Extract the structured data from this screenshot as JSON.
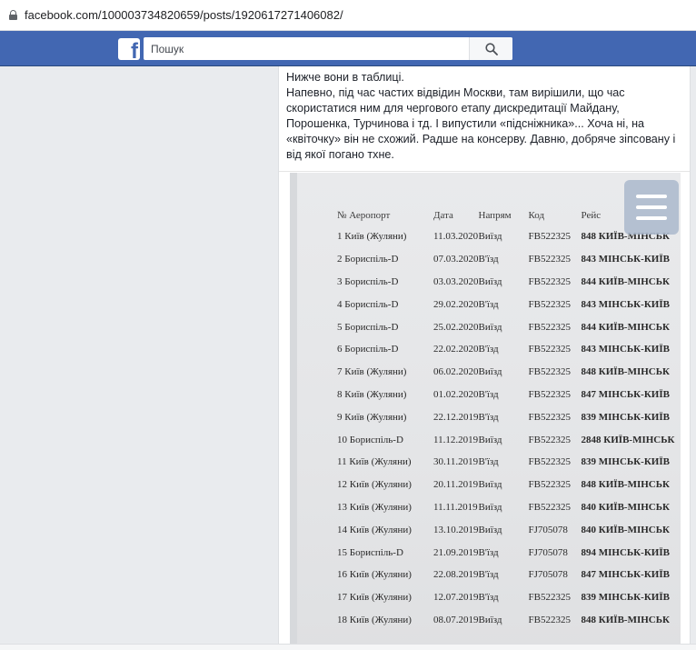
{
  "browser": {
    "url": "facebook.com/100003734820659/posts/1920617271406082/"
  },
  "header": {
    "search_placeholder": "Пошук",
    "logo_letter": "f"
  },
  "post": {
    "text_lines": [
      "Нижче вони в таблиці.",
      "Напевно, під час частих відвідин Москви, там вирішили, що час скористатися ним для чергового етапу дискредитації Майдану, Порошенка, Турчинова і тд. І випустили «підсніжника»... Хоча ні, на «квіточку» він не схожий. Радше на консерву. Давню, добряче зіпсовану і від якої погано тхне."
    ]
  },
  "table": {
    "headers": [
      "№ Аеропорт",
      "Дата",
      "Напрям",
      "Код",
      "Рейс"
    ],
    "rows": [
      [
        "1 Київ (Жуляни)",
        "11.03.2020",
        "Виїзд",
        "FB522325",
        "848 КИЇВ-МІНСЬК"
      ],
      [
        "2 Бориспіль-D",
        "07.03.2020",
        "В'їзд",
        "FB522325",
        "843 МІНСЬК-КИЇВ"
      ],
      [
        "3 Бориспіль-D",
        "03.03.2020",
        "Виїзд",
        "FB522325",
        "844 КИЇВ-МІНСЬК"
      ],
      [
        "4 Бориспіль-D",
        "29.02.2020",
        "В'їзд",
        "FB522325",
        "843 МІНСЬК-КИЇВ"
      ],
      [
        "5 Бориспіль-D",
        "25.02.2020",
        "Виїзд",
        "FB522325",
        "844 КИЇВ-МІНСЬК"
      ],
      [
        "6 Бориспіль-D",
        "22.02.2020",
        "В'їзд",
        "FB522325",
        "843 МІНСЬК-КИЇВ"
      ],
      [
        "7 Київ (Жуляни)",
        "06.02.2020",
        "Виїзд",
        "FB522325",
        "848 КИЇВ-МІНСЬК"
      ],
      [
        "8 Київ (Жуляни)",
        "01.02.2020",
        "В'їзд",
        "FB522325",
        "847 МІНСЬК-КИЇВ"
      ],
      [
        "9 Київ (Жуляни)",
        "22.12.2019",
        "В'їзд",
        "FB522325",
        "839 МІНСЬК-КИЇВ"
      ],
      [
        "10 Бориспіль-D",
        "11.12.2019",
        "Виїзд",
        "FB522325",
        "2848 КИЇВ-МІНСЬК"
      ],
      [
        "11 Київ (Жуляни)",
        "30.11.2019",
        "В'їзд",
        "FB522325",
        "839 МІНСЬК-КИЇВ"
      ],
      [
        "12 Київ (Жуляни)",
        "20.11.2019",
        "Виїзд",
        "FB522325",
        "848 КИЇВ-МІНСЬК"
      ],
      [
        "13 Київ (Жуляни)",
        "11.11.2019",
        "Виїзд",
        "FB522325",
        "840 КИЇВ-МІНСЬК"
      ],
      [
        "14 Київ (Жуляни)",
        "13.10.2019",
        "Виїзд",
        "FJ705078",
        "840 КИЇВ-МІНСЬК"
      ],
      [
        "15 Бориспіль-D",
        "21.09.2019",
        "В'їзд",
        "FJ705078",
        "894 МІНСЬК-КИЇВ"
      ],
      [
        "16 Київ (Жуляни)",
        "22.08.2019",
        "В'їзд",
        "FJ705078",
        "847 МІНСЬК-КИЇВ"
      ],
      [
        "17 Київ (Жуляни)",
        "12.07.2019",
        "В'їзд",
        "FB522325",
        "839 МІНСЬК-КИЇВ"
      ],
      [
        "18 Київ (Жуляни)",
        "08.07.2019",
        "Виїзд",
        "FB522325",
        "848 КИЇВ-МІНСЬК"
      ]
    ]
  },
  "colors": {
    "fb_blue": "#4267b2",
    "page_bg": "#e9ebee"
  },
  "icons": {
    "secure": "lock-icon",
    "search": "search-icon",
    "menu": "hamburger-menu-icon"
  }
}
